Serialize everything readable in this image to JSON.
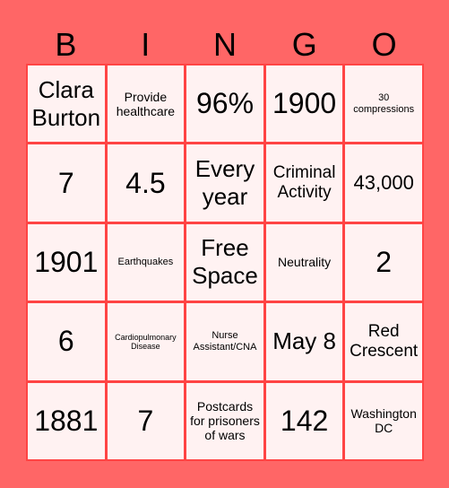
{
  "header": {
    "letters": [
      "B",
      "I",
      "N",
      "G",
      "O"
    ]
  },
  "colors": {
    "background": "#ff6666",
    "grid_lines": "#ff4444",
    "cell_fill": "#fff2f2"
  },
  "cells": [
    [
      "Clara Burton",
      "Provide healthcare",
      "96%",
      "1900",
      "30 compressions"
    ],
    [
      "7",
      "4.5",
      "Every year",
      "Criminal Activity",
      "43,000"
    ],
    [
      "1901",
      "Earthquakes",
      "Free Space",
      "Neutrality",
      "2"
    ],
    [
      "6",
      "Cardiopulmonary Disease",
      "Nurse Assistant/CNA",
      "May 8",
      "Red Crescent"
    ],
    [
      "1881",
      "7",
      "Postcards for prisoners of wars",
      "142",
      "Washington DC"
    ]
  ]
}
